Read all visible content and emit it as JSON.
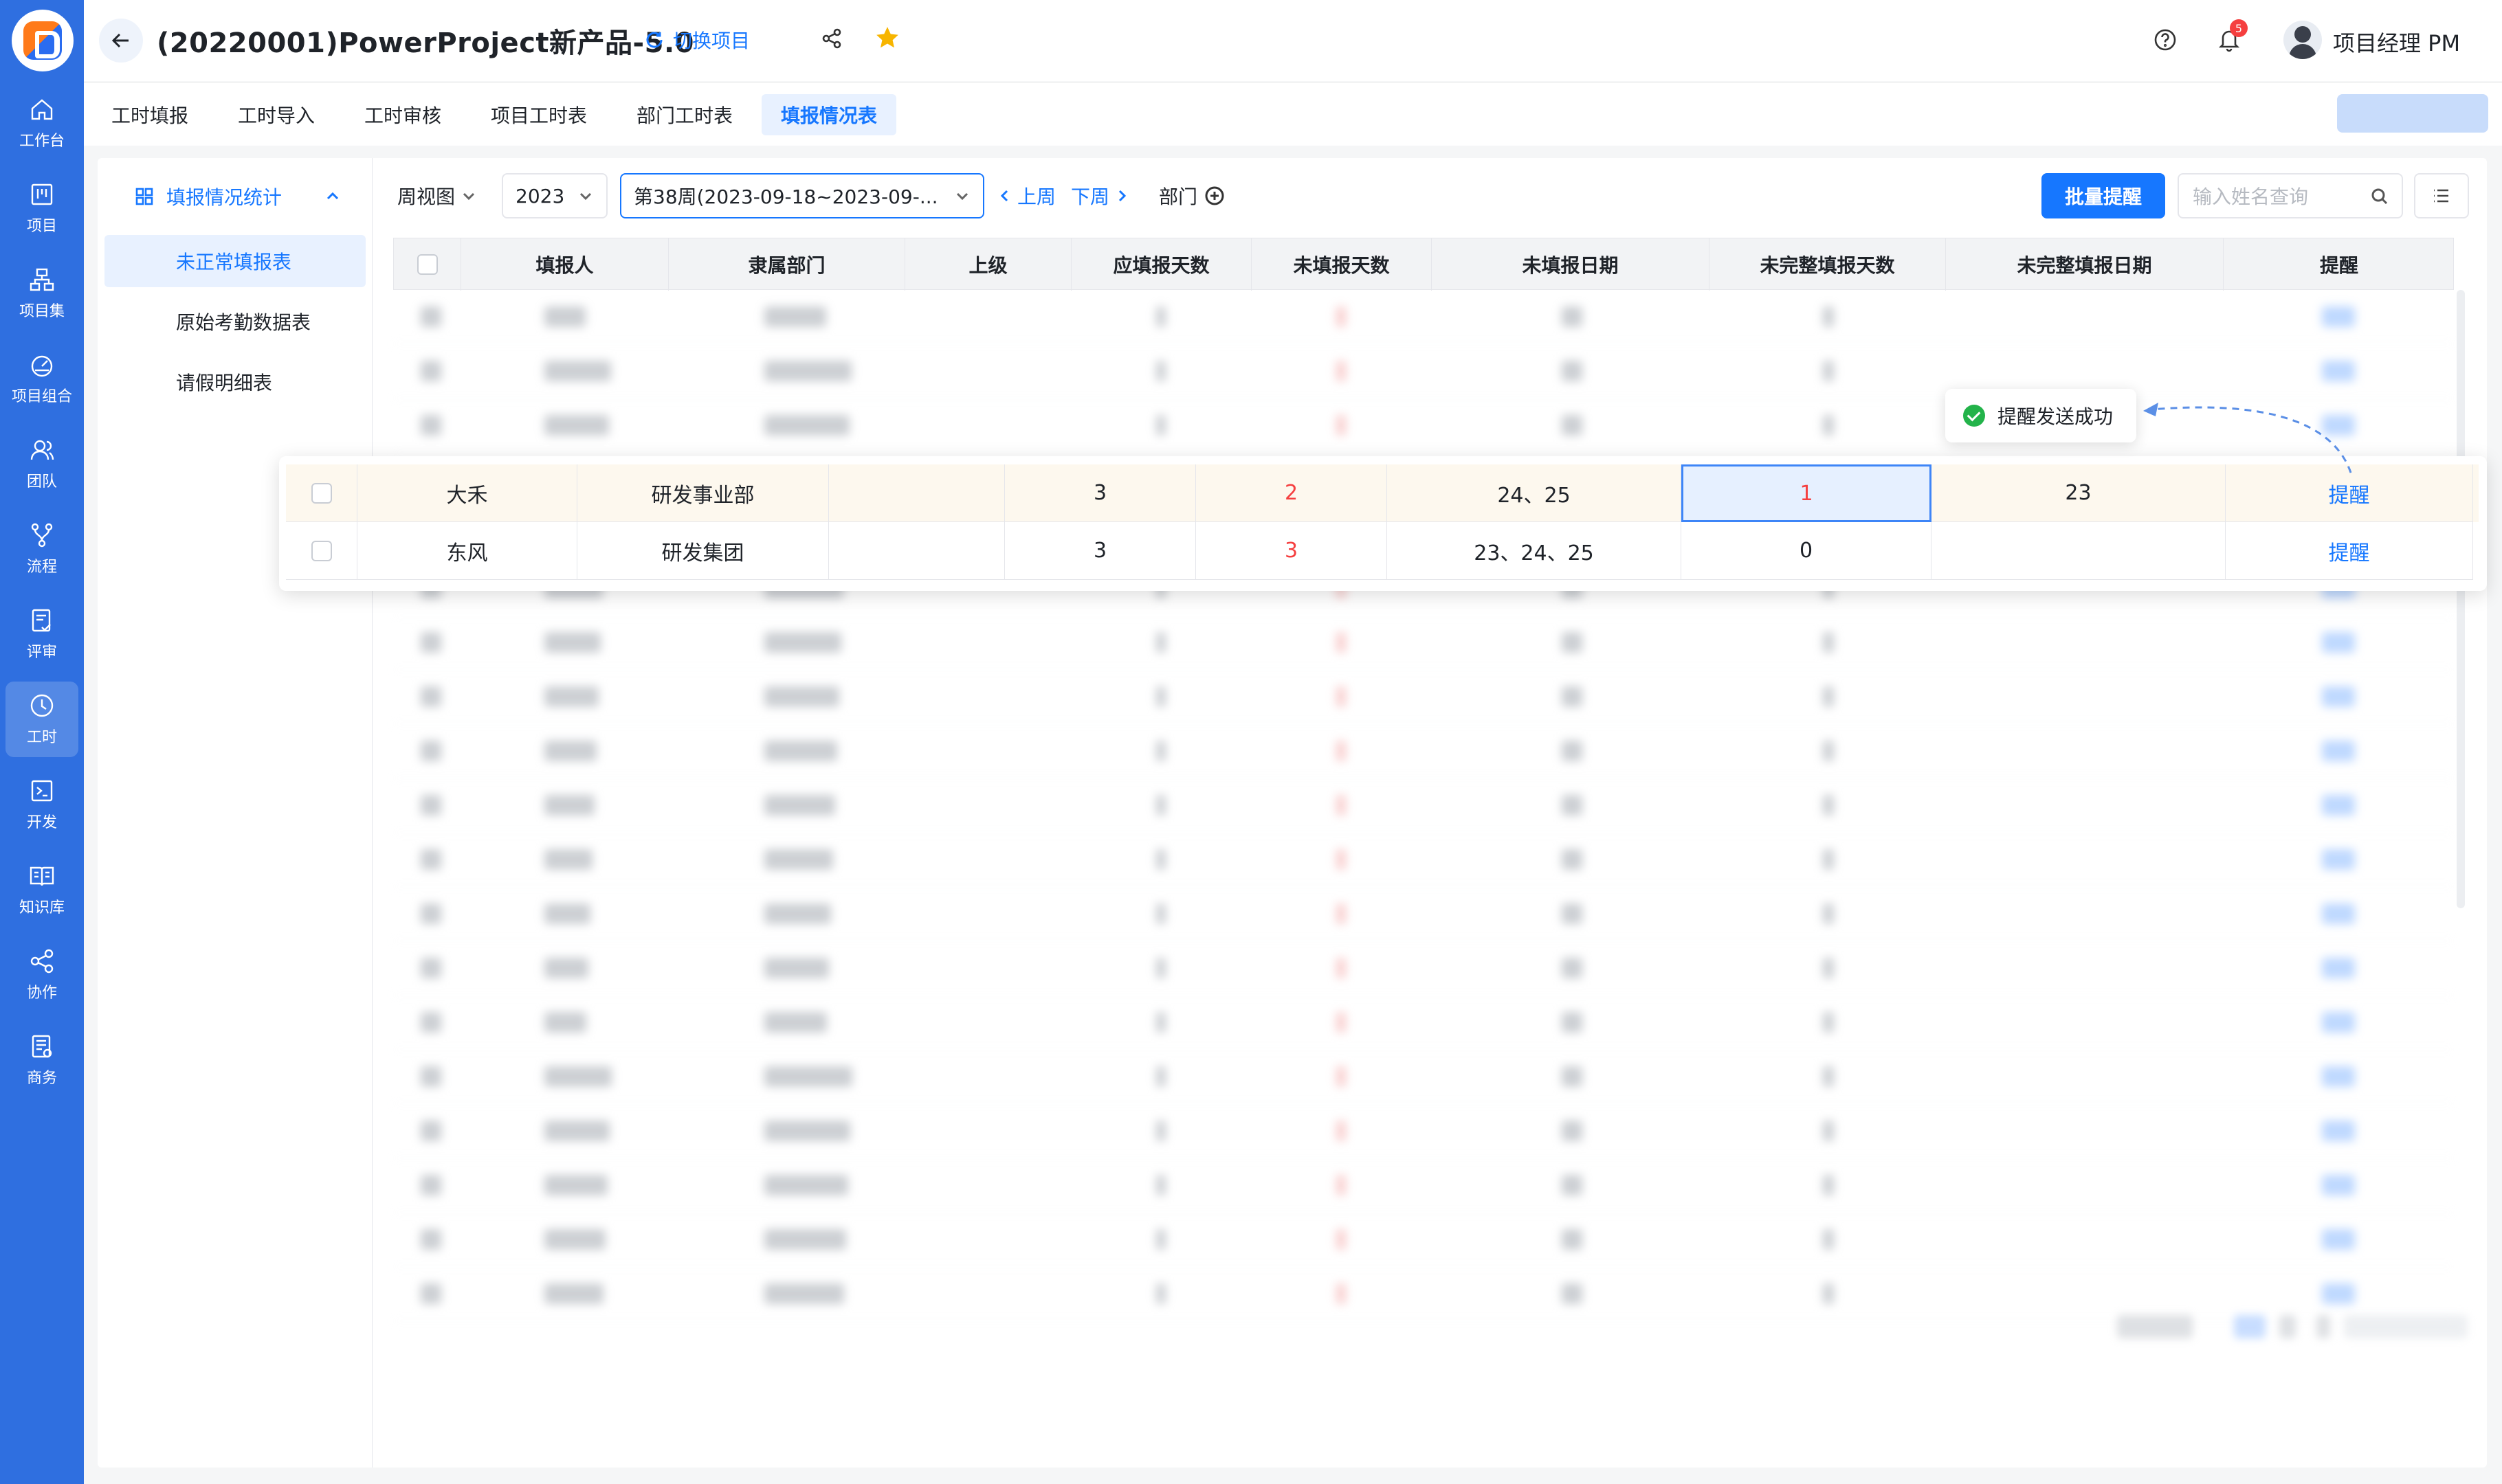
{
  "sidebar": {
    "items": [
      {
        "label": "工作台",
        "icon": "home-icon"
      },
      {
        "label": "项目",
        "icon": "kanban-icon"
      },
      {
        "label": "项目集",
        "icon": "hierarchy-icon"
      },
      {
        "label": "项目组合",
        "icon": "dashboard-icon"
      },
      {
        "label": "团队",
        "icon": "team-icon"
      },
      {
        "label": "流程",
        "icon": "flow-icon"
      },
      {
        "label": "评审",
        "icon": "review-icon"
      },
      {
        "label": "工时",
        "icon": "clock-icon"
      },
      {
        "label": "开发",
        "icon": "terminal-icon"
      },
      {
        "label": "知识库",
        "icon": "book-icon"
      },
      {
        "label": "协作",
        "icon": "share-icon"
      },
      {
        "label": "商务",
        "icon": "contract-icon"
      }
    ],
    "active_index": 7
  },
  "header": {
    "title": "(20220001)PowerProject新产品-5.0",
    "switch_label": "切换项目",
    "notification_count": "5",
    "user_name": "项目经理 PM"
  },
  "tabs": [
    "工时填报",
    "工时导入",
    "工时审核",
    "项目工时表",
    "部门工时表",
    "填报情况表"
  ],
  "active_tab": 5,
  "leftnav": {
    "group_label": "填报情况统计",
    "items": [
      "未正常填报表",
      "原始考勤数据表",
      "请假明细表"
    ]
  },
  "toolbar": {
    "view_label": "周视图",
    "year": "2023",
    "week": "第38周(2023-09-18~2023-09-...",
    "prev": "上周",
    "next": "下周",
    "dept": "部门",
    "batch_remind": "批量提醒",
    "search_placeholder": "输入姓名查询"
  },
  "table": {
    "columns": [
      "填报人",
      "隶属部门",
      "上级",
      "应填报天数",
      "未填报天数",
      "未填报日期",
      "未完整填报天数",
      "未完整填报日期",
      "提醒"
    ]
  },
  "popup_rows": [
    {
      "name": "大禾",
      "dept": "研发事业部",
      "superior": "",
      "should": "3",
      "missing": "2",
      "missing_dates": "24、25",
      "incomplete": "1",
      "incomplete_dates": "23",
      "action": "提醒"
    },
    {
      "name": "东风",
      "dept": "研发集团",
      "superior": "",
      "should": "3",
      "missing": "3",
      "missing_dates": "23、24、25",
      "incomplete": "0",
      "incomplete_dates": "",
      "action": "提醒"
    }
  ],
  "toast": "提醒发送成功",
  "colors": {
    "sidebar": "#2f6fe0",
    "primary": "#1677ff",
    "danger": "#f53f3f",
    "success": "#23b34a"
  }
}
